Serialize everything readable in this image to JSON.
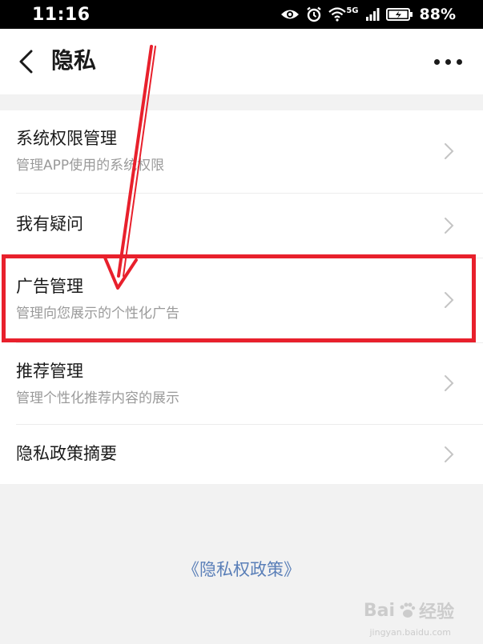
{
  "status_bar": {
    "time": "11:16",
    "battery": "88%",
    "network": "5G",
    "icons": [
      "eye-icon",
      "alarm-icon",
      "wifi-icon",
      "signal-icon",
      "battery-icon"
    ]
  },
  "nav": {
    "title": "隐私",
    "back_icon": "chevron-left-icon",
    "more_icon": "more-dots-icon"
  },
  "items": [
    {
      "title": "系统权限管理",
      "subtitle": "管理APP使用的系统权限"
    },
    {
      "title": "我有疑问",
      "subtitle": ""
    },
    {
      "title": "广告管理",
      "subtitle": "管理向您展示的个性化广告"
    },
    {
      "title": "推荐管理",
      "subtitle": "管理个性化推荐内容的展示"
    },
    {
      "title": "隐私政策摘要",
      "subtitle": ""
    }
  ],
  "footer": {
    "policy_link": "《隐私权政策》"
  },
  "watermark": {
    "brand": "Bai",
    "brand_suffix": "经验",
    "url": "jingyan.baidu.com"
  },
  "colors": {
    "accent_link": "#5a7fb8",
    "annotation_red": "#e8202c",
    "status_bar_bg": "#000000",
    "page_bg": "#f2f2f2"
  }
}
